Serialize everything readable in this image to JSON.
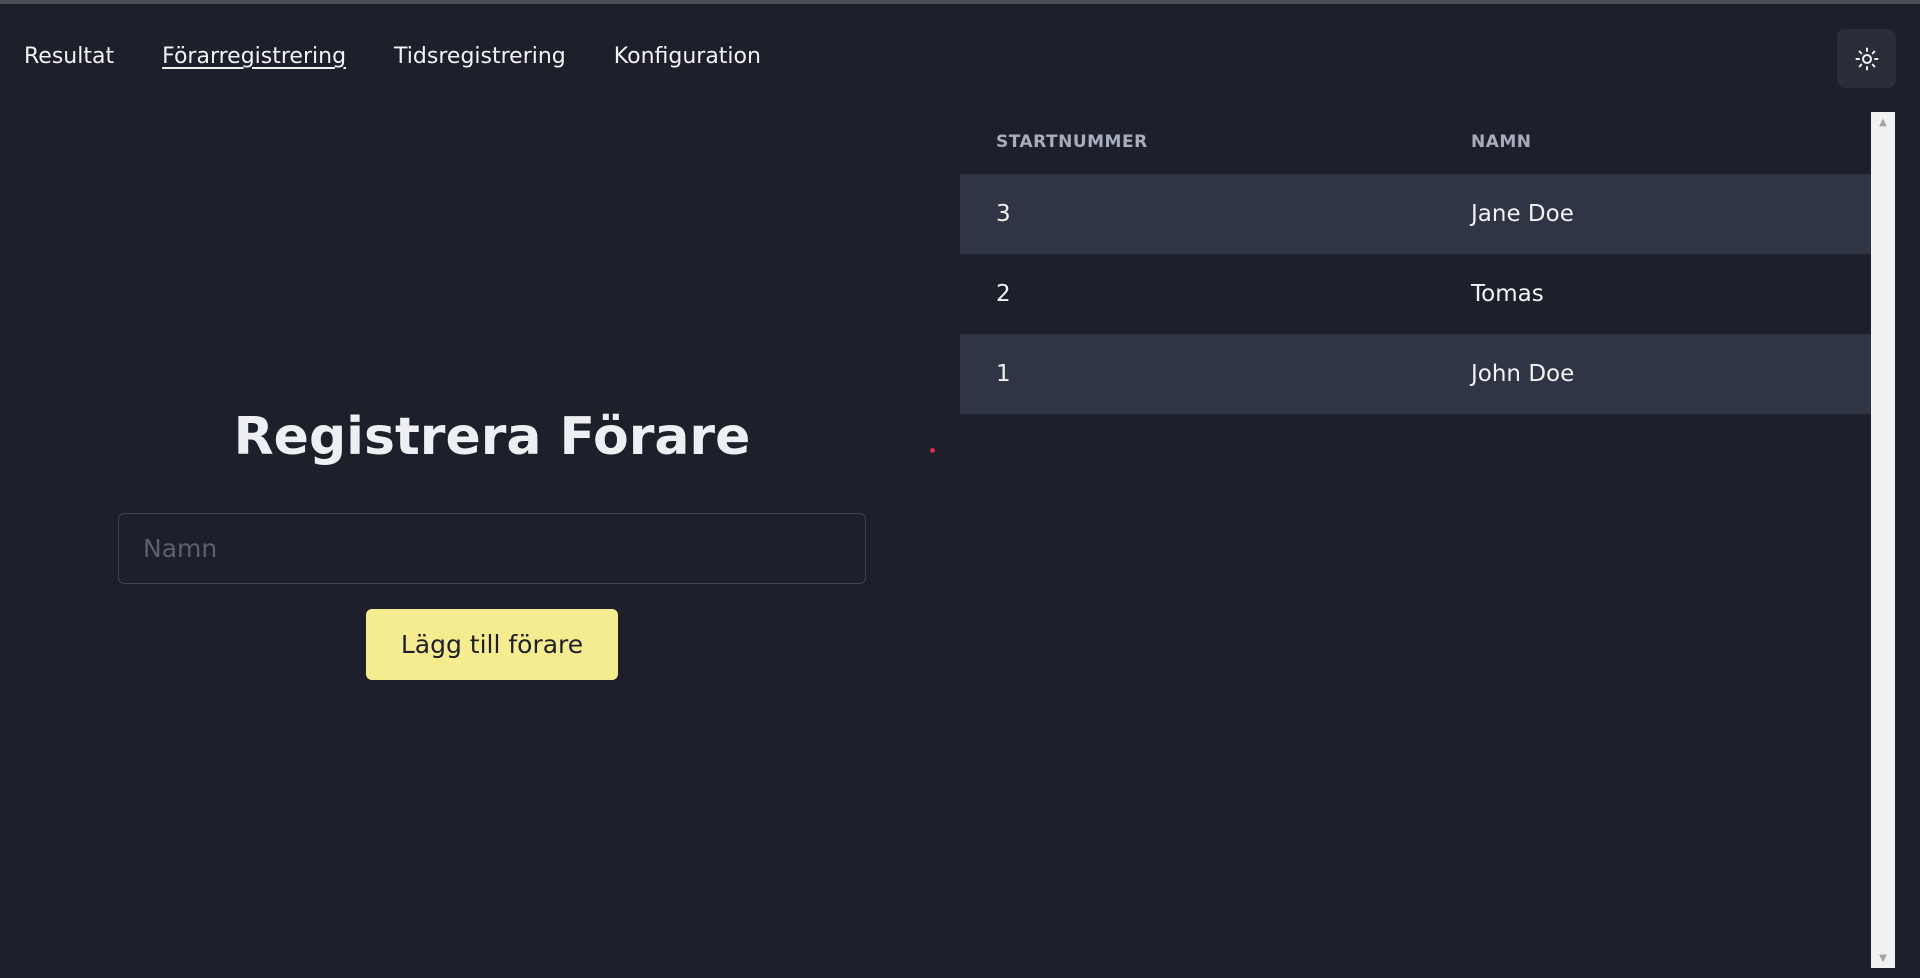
{
  "nav": {
    "items": [
      {
        "label": "Resultat",
        "active": false
      },
      {
        "label": "Förarregistrering",
        "active": true
      },
      {
        "label": "Tidsregistrering",
        "active": false
      },
      {
        "label": "Konfiguration",
        "active": false
      }
    ]
  },
  "theme_toggle": {
    "icon": "sun-icon"
  },
  "form": {
    "heading": "Registrera Förare",
    "name_placeholder": "Namn",
    "name_value": "",
    "add_button_label": "Lägg till förare"
  },
  "drivers_table": {
    "headers": [
      "STARTNUMMER",
      "NAMN"
    ],
    "rows": [
      {
        "startnummer": "3",
        "namn": "Jane Doe"
      },
      {
        "startnummer": "2",
        "namn": "Tomas"
      },
      {
        "startnummer": "1",
        "namn": "John Doe"
      }
    ]
  },
  "colors": {
    "background": "#1d202a",
    "row_alt": "#2f3545",
    "button_accent": "#f5ec8f",
    "header_text": "#a7adbd"
  }
}
